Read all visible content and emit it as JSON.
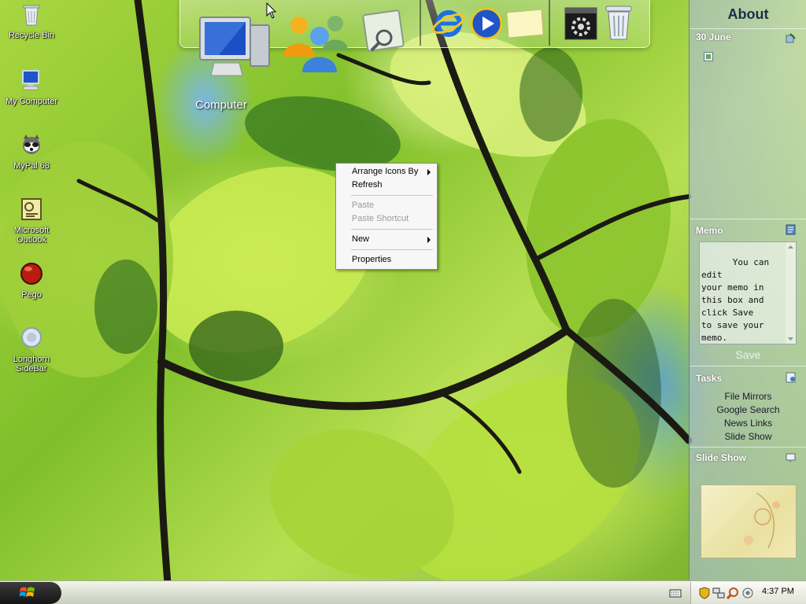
{
  "desktop_icons": [
    {
      "label": "Recycle Bin",
      "icon": "recycle-bin-icon"
    },
    {
      "label": "My Computer",
      "icon": "my-computer-icon"
    },
    {
      "label": "MyPal 68",
      "icon": "raccoon-icon"
    },
    {
      "label": "Microsoft Outlook",
      "icon": "outlook-icon"
    },
    {
      "label": "Pego",
      "icon": "red-ball-icon"
    },
    {
      "label": "Longhorn SideBar",
      "icon": "sidebar-icon"
    }
  ],
  "dock": {
    "computer_label": "Computer",
    "icons": [
      "computer-icon",
      "users-icon",
      "search-icon",
      "internet-explorer-icon",
      "media-player-icon",
      "notes-icon",
      "settings-icon",
      "recycle-bin-icon"
    ]
  },
  "context_menu": {
    "items": [
      {
        "label": "Arrange Icons By",
        "disabled": false,
        "submenu": true
      },
      {
        "label": "Refresh",
        "disabled": false,
        "submenu": false
      },
      {
        "label": "Paste",
        "disabled": true,
        "submenu": false
      },
      {
        "label": "Paste Shortcut",
        "disabled": true,
        "submenu": false
      },
      {
        "label": "New",
        "disabled": false,
        "submenu": true
      },
      {
        "label": "Properties",
        "disabled": false,
        "submenu": false
      }
    ]
  },
  "sidebar": {
    "title": "About",
    "date": "30 June",
    "memo": {
      "title": "Memo",
      "text": "You can edit\nyour memo in\nthis box and\nclick Save\nto save your\nmemo.",
      "save_label": "Save"
    },
    "tasks": {
      "title": "Tasks",
      "items": [
        "File Mirrors",
        "Google Search",
        "News Links",
        "Slide Show"
      ]
    },
    "slideshow": {
      "title": "Slide Show"
    }
  },
  "taskbar": {
    "clock": "4:37 PM",
    "tray_icons": [
      "keyboard-icon",
      "shield-icon",
      "network-icon",
      "search-icon",
      "volume-icon"
    ]
  },
  "colors": {
    "sidebar_title": "#1b2e4a",
    "menu_disabled": "#9a9a9a"
  }
}
